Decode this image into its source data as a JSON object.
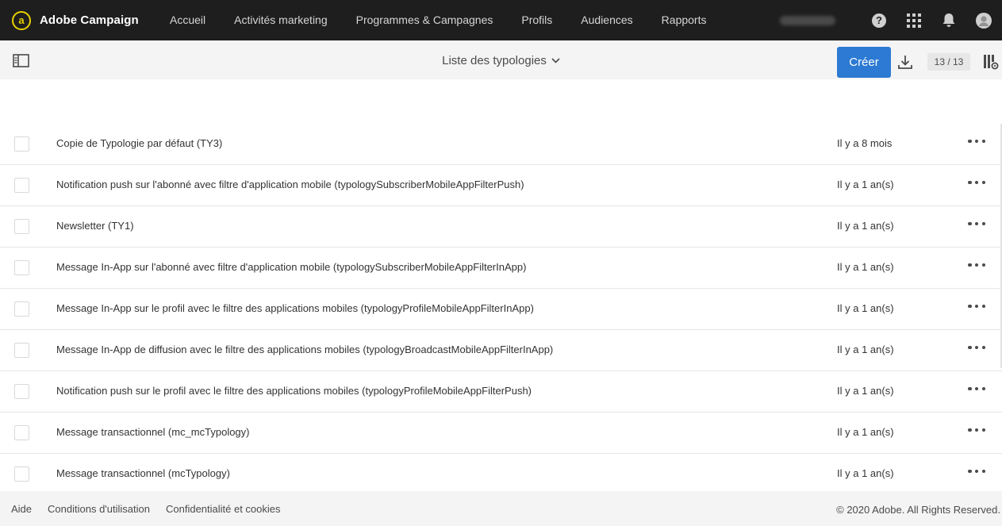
{
  "app": {
    "brand_name": "Adobe Campaign",
    "brand_logo_glyph": "a",
    "accent": "#e8d100"
  },
  "nav": {
    "items": [
      {
        "label": "Accueil"
      },
      {
        "label": "Activités marketing"
      },
      {
        "label": "Programmes & Campagnes"
      },
      {
        "label": "Profils"
      },
      {
        "label": "Audiences"
      },
      {
        "label": "Rapports"
      }
    ]
  },
  "top_right": {
    "help_glyph": "?",
    "icons": [
      "help-icon",
      "apps-grid-icon",
      "bell-icon",
      "user-avatar-icon"
    ]
  },
  "toolbar": {
    "title": "Liste des typologies",
    "create_label": "Créer",
    "create_color": "#2c7ad3",
    "count": "13 / 13"
  },
  "rows": [
    {
      "label": "Copie de Typologie par défaut (TY3)",
      "date": "Il y a 8 mois"
    },
    {
      "label": "Notification push sur l'abonné avec filtre d'application mobile (typologySubscriberMobileAppFilterPush)",
      "date": "Il y a 1 an(s)"
    },
    {
      "label": "Newsletter (TY1)",
      "date": "Il y a 1 an(s)"
    },
    {
      "label": "Message In-App sur l'abonné avec filtre d'application mobile (typologySubscriberMobileAppFilterInApp)",
      "date": "Il y a 1 an(s)"
    },
    {
      "label": "Message In-App sur le profil avec le filtre des applications mobiles (typologyProfileMobileAppFilterInApp)",
      "date": "Il y a 1 an(s)"
    },
    {
      "label": "Message In-App de diffusion avec le filtre des applications mobiles (typologyBroadcastMobileAppFilterInApp)",
      "date": "Il y a 1 an(s)"
    },
    {
      "label": "Notification push sur le profil avec le filtre des applications mobiles (typologyProfileMobileAppFilterPush)",
      "date": "Il y a 1 an(s)"
    },
    {
      "label": "Message transactionnel (mc_mcTypology)",
      "date": "Il y a 1 an(s)"
    },
    {
      "label": "Message transactionnel (mcTypology)",
      "date": "Il y a 1 an(s)"
    }
  ],
  "footer": {
    "links": [
      {
        "label": "Aide"
      },
      {
        "label": "Conditions d'utilisation"
      },
      {
        "label": "Confidentialité et cookies"
      }
    ],
    "copyright": "© 2020 Adobe. All Rights Reserved."
  }
}
